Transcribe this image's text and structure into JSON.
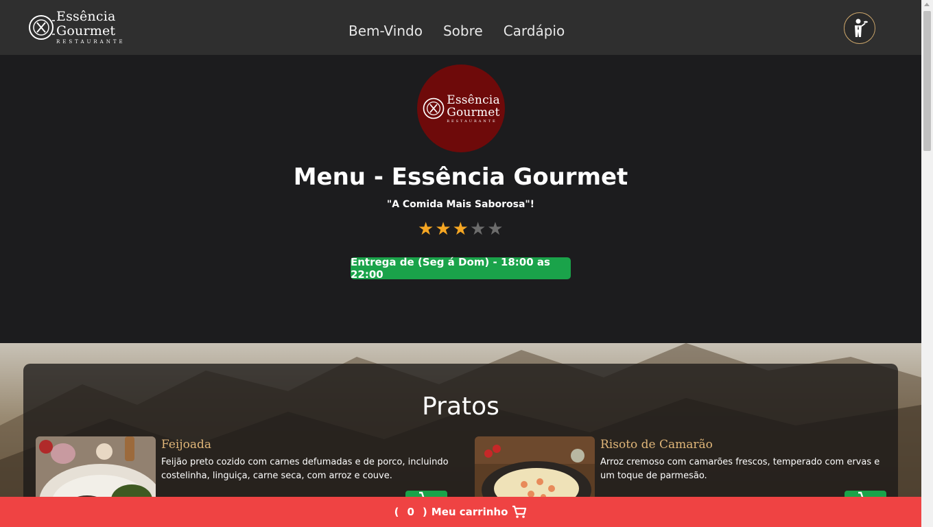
{
  "brand": {
    "line1": "Essência",
    "line2": "Gourmet",
    "sub": "RESTAURANTE"
  },
  "nav": {
    "items": [
      {
        "label": "Bem-Vindo"
      },
      {
        "label": "Sobre"
      },
      {
        "label": "Cardápio"
      }
    ]
  },
  "header": {
    "waiter_icon": "waiter-icon"
  },
  "hero": {
    "title": "Menu - Essência Gourmet",
    "tagline": "\"A Comida Mais Saborosa\"!",
    "rating": 3,
    "rating_max": 5,
    "delivery": "Entrega de (Seg á Dom) - 18:00 as 22:00"
  },
  "menu": {
    "section_title": "Pratos",
    "dishes": [
      {
        "name": "Feijoada",
        "description": "Feijão preto cozido com carnes defumadas e de porco, incluindo costelinha, linguiça, carne seca, com arroz e couve."
      },
      {
        "name": "Risoto de Camarão",
        "description": "Arroz cremoso com camarões frescos, temperado com ervas e um toque de parmesão."
      }
    ]
  },
  "cart": {
    "open": "(",
    "count": "0",
    "close": ")",
    "label": "Meu carrinho",
    "icon": "cart-icon"
  },
  "colors": {
    "header": "#2f2f2f",
    "hero": "#1c1c1e",
    "logo_circle": "#6e0a0a",
    "accent_green": "#1aa34a",
    "cart_red": "#ef4343",
    "dish_name": "#e0b679",
    "star_on": "#f5a623"
  }
}
